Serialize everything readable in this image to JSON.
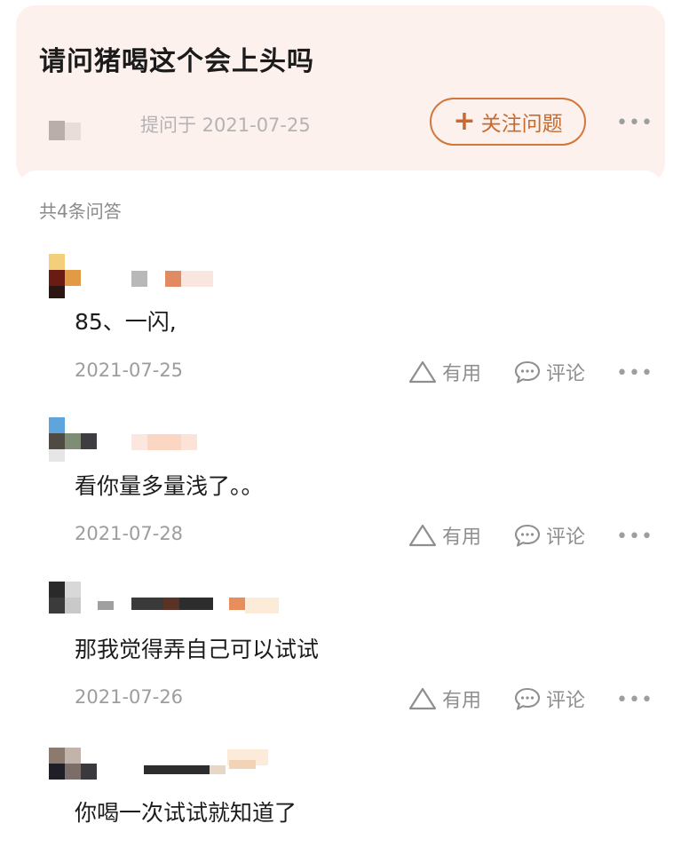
{
  "question": {
    "title": "请问猪喝这个会上头吗",
    "asked_date": "提问于 2021-07-25",
    "follow_button": "关注问题",
    "follow_icon": "plus-icon"
  },
  "answers_header": {
    "count_text": "共4条问答"
  },
  "answers": [
    {
      "text": "85、一闪,",
      "date": "2021-07-25",
      "useful_label": "有用",
      "comment_label": "评论"
    },
    {
      "text": "看你量多量浅了。。",
      "date": "2021-07-28",
      "useful_label": "有用",
      "comment_label": "评论"
    },
    {
      "text": "那我觉得弄自己可以试试",
      "date": "2021-07-26",
      "useful_label": "有用",
      "comment_label": "评论"
    },
    {
      "text": "你喝一次试试就知道了"
    }
  ],
  "colors": {
    "header_bg": "#fdf1ee",
    "accent": "#d2773a",
    "muted_text": "#9d9d9d"
  },
  "icons": {
    "useful": "triangle-outline-icon",
    "comment": "speech-bubble-icon",
    "more": "more-dots-icon"
  }
}
